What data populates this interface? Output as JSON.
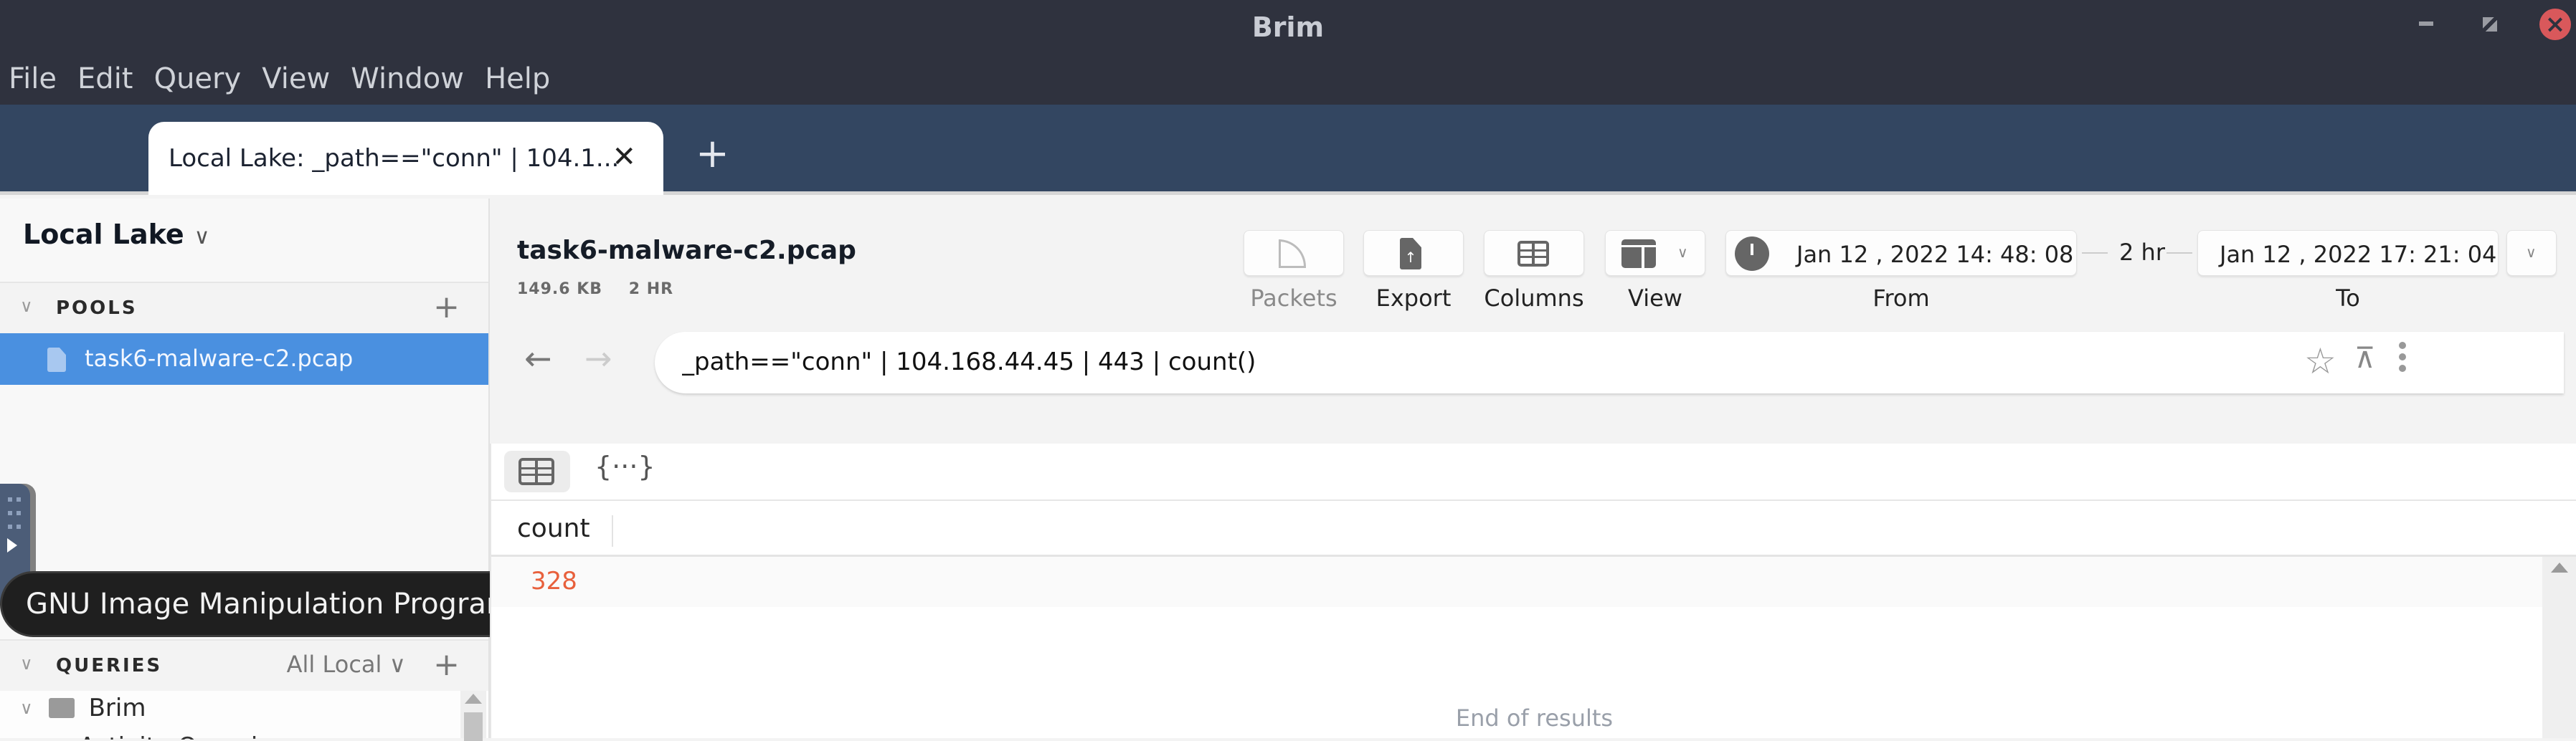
{
  "window": {
    "title": "Brim",
    "minimize_icon": "minimize-icon",
    "maximize_icon": "maximize-icon",
    "close_icon": "close-icon"
  },
  "menu": [
    "File",
    "Edit",
    "Query",
    "View",
    "Window",
    "Help"
  ],
  "tabs": [
    {
      "label": "Local Lake: _path==\"conn\" | 104.1...",
      "close": "✕",
      "active": true
    }
  ],
  "new_tab_label": "+",
  "sidebar": {
    "lake_name": "Local Lake",
    "lake_chevron": "∨",
    "pools_header": "POOLS",
    "pools_add": "+",
    "pools": [
      {
        "label": "task6-malware-c2.pcap",
        "selected": true
      }
    ],
    "queries_header": "QUERIES",
    "queries_filter": "All Local ∨",
    "queries_add": "+",
    "query_folders": [
      {
        "label": "Brim",
        "expanded": true,
        "children": [
          "Activity Overview"
        ]
      }
    ],
    "section_arrow": "∨"
  },
  "tooltip": {
    "text": "GNU Image Manipulation Program"
  },
  "pool_header": {
    "title": "task6-malware-c2.pcap",
    "size": "149.6 KB",
    "duration": "2 HR"
  },
  "toolbar": {
    "packets_label": "Packets",
    "export_label": "Export",
    "columns_label": "Columns",
    "view_label": "View",
    "from_label": "From",
    "to_label": "To",
    "from_value": "Jan 12 , 2022  14: 48: 08",
    "to_value": "Jan 12 , 2022  17: 21: 04",
    "span": "2 hr",
    "chevron": "∨"
  },
  "search": {
    "back": "←",
    "forward": "→",
    "value": "_path==\"conn\" | 104.168.44.45 | 443 | count()",
    "star": "☆",
    "pin": "⊼",
    "accent": "#4a90e0"
  },
  "results": {
    "json_view_label": "{···}",
    "columns": [
      "count"
    ],
    "rows": [
      [
        "328"
      ]
    ],
    "end_text": "End of results",
    "value_color": "#e8603c"
  }
}
